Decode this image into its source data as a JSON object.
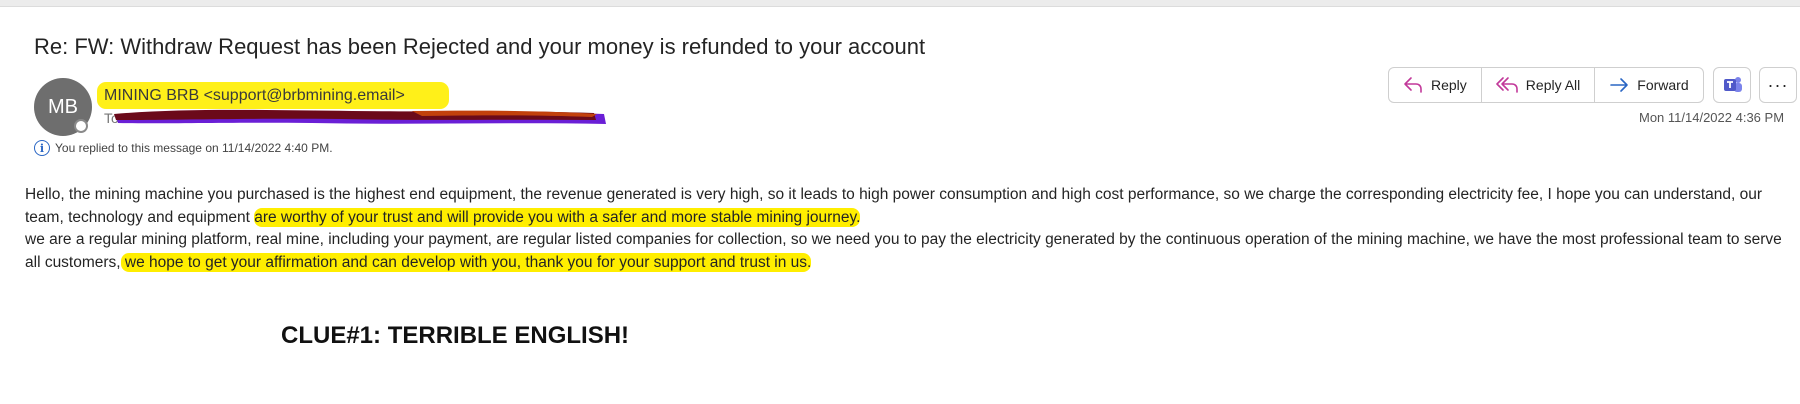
{
  "email": {
    "subject": "Re: FW: Withdraw Request has been Rejected and your money is refunded to your account",
    "avatar_initials": "MB",
    "sender": "MINING BRB <support@brbmining.email>",
    "to_label": "To",
    "replied_notice": "You replied to this message on 11/14/2022 4:40 PM.",
    "date": "Mon 11/14/2022 4:36 PM",
    "actions": {
      "reply": "Reply",
      "reply_all": "Reply All",
      "forward": "Forward",
      "more": "···"
    },
    "body": {
      "p1_plain": "Hello, the mining machine you purchased is the highest end equipment, the revenue generated is very high, so it leads to high power consumption and high cost performance, so we charge the corresponding electricity fee, I hope you can understand, our team, technology and equipment ",
      "p1_marked": "are worthy of your trust and will provide you with a safer and more stable mining journey.",
      "p2_plain": "we are a regular mining platform, real mine, including your payment, are regular listed companies for collection, so we need you to pay the electricity generated by the continuous operation of the mining machine, we have the most professional team to serve all customers,",
      "p2_marked": " we hope to get your affirmation and can develop with you, thank you for your support and trust in us."
    }
  },
  "annotation": {
    "clue": "CLUE#1: TERRIBLE ENGLISH!"
  },
  "colors": {
    "highlight": "#ffee00",
    "redaction_dark": "#6b0a1a",
    "redaction_purple": "#6a1fd6",
    "accent": "#2a66c4"
  },
  "icons": [
    "info-icon",
    "reply-icon",
    "reply-all-icon",
    "forward-icon",
    "teams-icon",
    "more-icon"
  ]
}
